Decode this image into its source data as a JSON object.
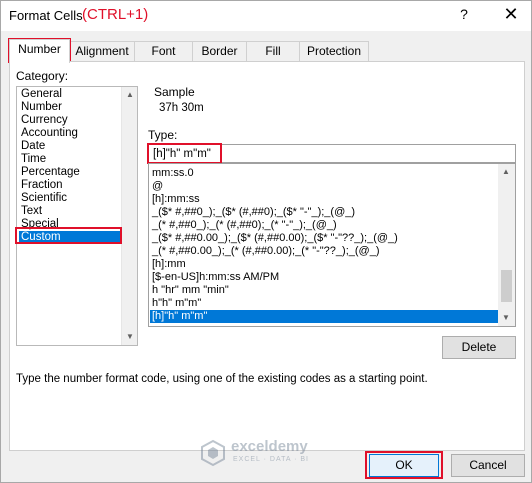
{
  "window": {
    "title": "Format Cells",
    "title_annotation": "(CTRL+1)",
    "help_label": "?",
    "close_label": "✕"
  },
  "tabs": [
    {
      "label": "Number",
      "active": true
    },
    {
      "label": "Alignment"
    },
    {
      "label": "Font"
    },
    {
      "label": "Border"
    },
    {
      "label": "Fill"
    },
    {
      "label": "Protection"
    }
  ],
  "category": {
    "label": "Category:",
    "items": [
      "General",
      "Number",
      "Currency",
      "Accounting",
      "Date",
      "Time",
      "Percentage",
      "Fraction",
      "Scientific",
      "Text",
      "Special",
      "Custom"
    ],
    "selected": "Custom"
  },
  "sample": {
    "label": "Sample",
    "value": "37h 30m"
  },
  "type": {
    "label": "Type:",
    "value": "[h]\"h\" m\"m\""
  },
  "formats": {
    "items": [
      "mm:ss.0",
      "@",
      "[h]:mm:ss",
      "_($* #,##0_);_($* (#,##0);_($* \"-\"_);_(@_)",
      "_(* #,##0_);_(* (#,##0);_(* \"-\"_);_(@_)",
      "_($* #,##0.00_);_($* (#,##0.00);_($* \"-\"??_);_(@_)",
      "_(* #,##0.00_);_(* (#,##0.00);_(* \"-\"??_);_(@_)",
      "[h]:mm",
      "[$-en-US]h:mm:ss AM/PM",
      "h \"hr\" mm \"min\"",
      "h\"h\" m\"m\"",
      "[h]\"h\" m\"m\""
    ],
    "selected": "[h]\"h\" m\"m\""
  },
  "buttons": {
    "delete": "Delete",
    "ok": "OK",
    "cancel": "Cancel"
  },
  "hint": "Type the number format code, using one of the existing codes as a starting point.",
  "watermark": {
    "name": "exceldemy",
    "tagline": "EXCEL · DATA · BI"
  },
  "colors": {
    "accent": "#0078d7",
    "annotation_red": "#e0102a"
  }
}
